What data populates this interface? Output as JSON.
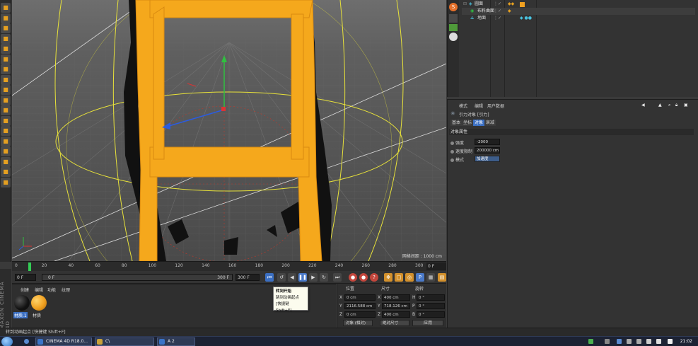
{
  "left_toolbar": {
    "tools": [
      "undo-icon",
      "redo-icon",
      "live-select-icon",
      "move-icon",
      "scale-icon",
      "rotate-icon",
      "cube-icon",
      "cube-edit-icon",
      "model-mode-icon",
      "texture-mode-icon",
      "polygon-icon",
      "axis-icon",
      "snap-icon",
      "lock-icon",
      "magnet-icon",
      "paint-icon",
      "grid-icon",
      "layer-icon"
    ],
    "brand": "MAXON CINEMA 4D"
  },
  "viewport": {
    "label": "网格间距 : 1000 cm"
  },
  "timeline": {
    "ticks": [
      "0",
      "20",
      "40",
      "60",
      "80",
      "100",
      "120",
      "140",
      "160",
      "180",
      "200",
      "220",
      "240",
      "260",
      "280",
      "300"
    ],
    "end_field": "0 F",
    "playhead_frame": 10
  },
  "transport": {
    "start_frame": "0 F",
    "range_start": "0 F",
    "range_end": "300 F",
    "end_frame": "300 F",
    "buttons": [
      "go-to-start-icon",
      "step-back-icon",
      "play-back-icon",
      "play-forward-icon",
      "pause-icon",
      "step-forward-icon",
      "go-to-end-icon",
      "record-icon",
      "autokey-icon",
      "keyframe-icon",
      "move-key-icon",
      "scale-key-icon",
      "rotate-key-icon",
      "param-key-icon",
      "pla-key-icon",
      "motion-icon"
    ]
  },
  "tooltip": {
    "title": "转到开始",
    "line2": "跳到动画起点",
    "shortcut": "[快捷键 Shift+F]"
  },
  "material_panel": {
    "menu": [
      "创建",
      "编辑",
      "功能",
      "纹理"
    ],
    "materials": [
      {
        "label": "材质.1",
        "color": "#111111"
      },
      {
        "label": "材质",
        "color": "#f0a020"
      }
    ]
  },
  "coord_panel": {
    "headers": [
      "位置",
      "尺寸",
      "旋转"
    ],
    "rows": [
      {
        "axis": "X",
        "pos": "0 cm",
        "size_axis": "X",
        "size": "400 cm",
        "rot_axis": "H",
        "rot": "0 °"
      },
      {
        "axis": "Y",
        "pos": "2116.588 cm",
        "size_axis": "Y",
        "size": "718.126 cm",
        "rot_axis": "P",
        "rot": "0 °"
      },
      {
        "axis": "Z",
        "pos": "0 cm",
        "size_axis": "Z",
        "size": "400 cm",
        "rot_axis": "B",
        "rot": "0 °"
      }
    ],
    "mode_object": "对象 (相对)",
    "mode_size": "绝对尺寸",
    "apply": "应用"
  },
  "object_manager": {
    "rows": [
      {
        "name": "圆面",
        "indent": 0
      },
      {
        "name": "布料曲面",
        "indent": 1
      },
      {
        "name": "地面",
        "indent": 1
      }
    ]
  },
  "attribute_manager": {
    "menu": [
      "模式",
      "编辑",
      "用户数据"
    ],
    "title": "引力对象 [引力]",
    "tabs": [
      "基本",
      "坐标",
      "对象",
      "衰减"
    ],
    "active_tab": 2,
    "section": "对象属性",
    "params": [
      {
        "label": "强度",
        "value": "-2000"
      },
      {
        "label": "速度限制",
        "value": "200000 cm"
      },
      {
        "label": "模式",
        "value": "加速度"
      }
    ]
  },
  "statusbar": {
    "text": "转到动画起点 [快捷键 Shift+F]"
  },
  "taskbar": {
    "tasks": [
      {
        "label": "CINEMA 4D R18.0...",
        "color": "#3a74c8"
      },
      {
        "label": "C\\",
        "color": "#c9a23a"
      },
      {
        "label": "A 2",
        "color": "#3a74c8"
      }
    ],
    "clock": "21:02"
  },
  "colors": {
    "accent": "#3b6fc2",
    "yellow_guides": "#e8e23a",
    "orange_object": "#f5a81c",
    "viewport_bg": "#4d4d4d"
  }
}
